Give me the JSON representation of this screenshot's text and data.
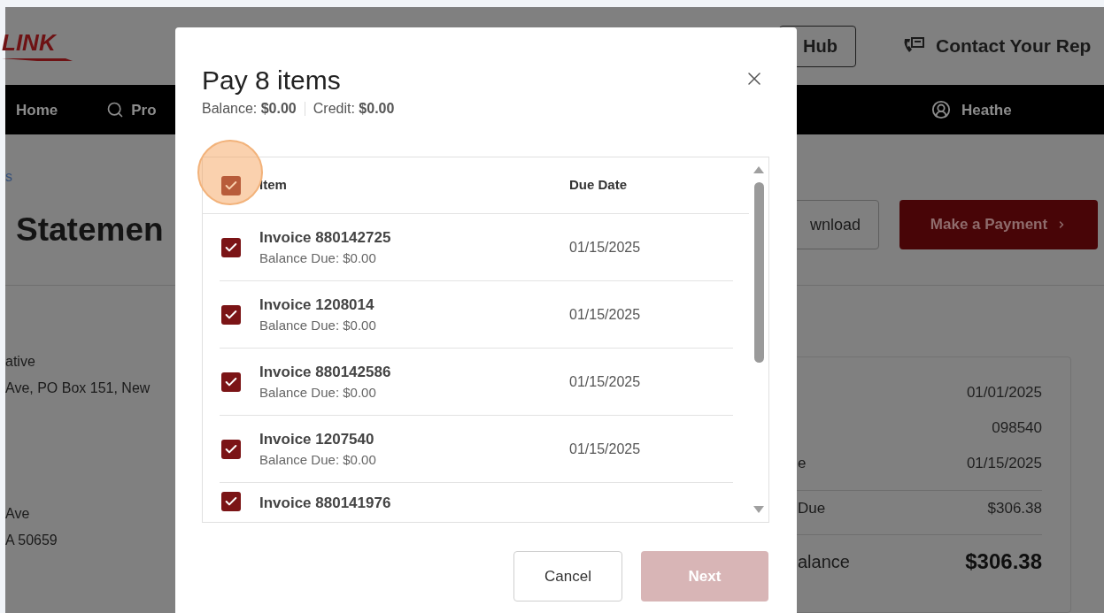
{
  "header": {
    "logo": "LINK",
    "hub_button": "Hub",
    "contact": "Contact Your Rep"
  },
  "nav": {
    "home": "Home",
    "search_item": "Pro",
    "user": "Heathe"
  },
  "page": {
    "breadcrumb": "s",
    "title": "Statemen",
    "download_button": "wnload",
    "pay_button": "Make a Payment",
    "address_blocks": [
      [
        "ative",
        "Ave, PO Box 151, New"
      ],
      [
        "Ave",
        "A 50659"
      ]
    ],
    "summary": [
      {
        "kind": "row",
        "value": "01/01/2025",
        "divider_before": false
      },
      {
        "kind": "row",
        "value": "098540",
        "divider_before": false
      },
      {
        "kind": "row",
        "label": "e",
        "value": "01/15/2025",
        "divider_before": false
      },
      {
        "kind": "row",
        "label": "Due",
        "value": "$306.38",
        "divider_before": true
      },
      {
        "kind": "total",
        "label": "alance",
        "value": "$306.38",
        "divider_before": true
      }
    ]
  },
  "modal": {
    "title": "Pay 8 items",
    "balance": "Balance: **$0.00**",
    "credit": "Credit: **$0.00**",
    "columns": [
      "Item",
      "Due Date"
    ],
    "select_all": {
      "checked": true
    },
    "rows": [
      {
        "title": "Invoice 880142725",
        "subtitle": "Balance Due: $0.00",
        "due_date": "01/15/2025",
        "checked": true
      },
      {
        "title": "Invoice 1208014",
        "subtitle": "Balance Due: $0.00",
        "due_date": "01/15/2025",
        "checked": true
      },
      {
        "title": "Invoice 880142586",
        "subtitle": "Balance Due: $0.00",
        "due_date": "01/15/2025",
        "checked": true
      },
      {
        "title": "Invoice 1207540",
        "subtitle": "Balance Due: $0.00",
        "due_date": "01/15/2025",
        "checked": true
      },
      {
        "title": "Invoice 880141976",
        "checked": true
      }
    ],
    "buttons": [
      {
        "label": "Cancel",
        "kind": "secondary",
        "disabled": false
      },
      {
        "label": "Next",
        "kind": "primary",
        "disabled": true
      }
    ]
  }
}
